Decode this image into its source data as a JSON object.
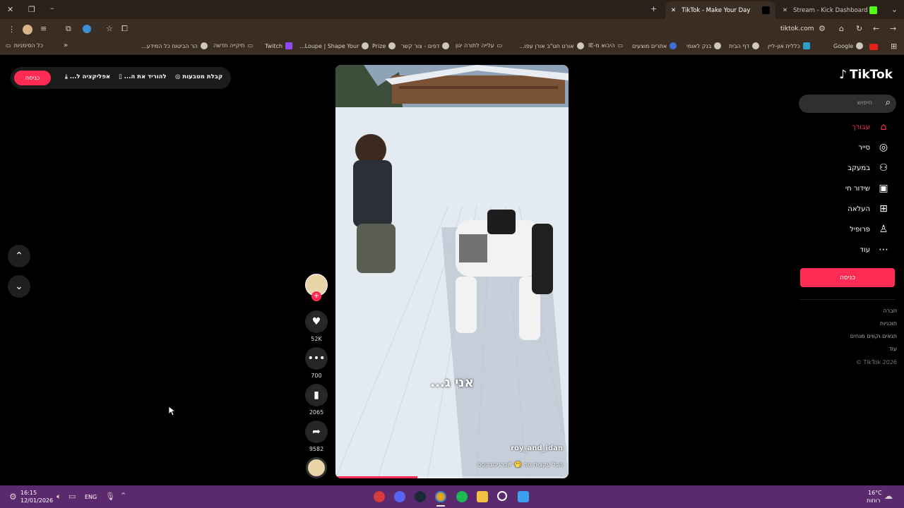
{
  "browser": {
    "tabs": [
      {
        "title": "TikTok - Make Your Day",
        "active": true
      },
      {
        "title": "Stream - Kick Dashboard",
        "active": false
      }
    ],
    "url": "tiktok.com",
    "bookmarks": [
      "Google",
      "כללית און-ליין",
      "דף הבית",
      "בנק לאומי",
      "אתרים מוצעים",
      "היבוא מ-IE",
      "אורט חט\"ב אורן עפו...",
      "עלייה לתורה יגון",
      "דפים - צור קשר",
      "Prize",
      "Loupe | Shape Your...",
      "Twitch",
      "תיקייה חדשה",
      "הר הביטוח כל המידע..."
    ],
    "all_bookmarks": "כל הסימניות"
  },
  "topbar": {
    "login": "כניסה",
    "coins": "קבלת מטבעות",
    "download": "להוריד את ה...",
    "app": "אפליקציה ל..."
  },
  "video": {
    "caption_overlay": "אני ג...",
    "username": "roy_and_idan",
    "description": "הכל עקבות סה 🤭 #כרגיגובקסט",
    "progress": 0.35
  },
  "actions": {
    "likes": "52K",
    "comments": "700",
    "saves": "2065",
    "shares": "9582"
  },
  "sidebar": {
    "logo": "TikTok",
    "search_placeholder": "חיפוש",
    "items": [
      {
        "label": "עבורך",
        "icon": "home-icon",
        "active": true
      },
      {
        "label": "סייר",
        "icon": "compass-icon"
      },
      {
        "label": "במעקב",
        "icon": "following-icon"
      },
      {
        "label": "שידור חי",
        "icon": "live-icon"
      },
      {
        "label": "העלאה",
        "icon": "upload-icon"
      },
      {
        "label": "פרופיל",
        "icon": "profile-icon"
      },
      {
        "label": "עוד",
        "icon": "more-icon"
      }
    ],
    "login_button": "כניסה",
    "footer": [
      "חברה",
      "תוכניות",
      "תנאים וקווים מנחים",
      "עוד",
      "TikTok 2026 ©"
    ]
  },
  "taskbar": {
    "time": "16:15",
    "date": "12/01/2026",
    "lang": "ENG",
    "weather_temp": "16°C",
    "weather_desc": "רוחות"
  },
  "colors": {
    "accent": "#fe2c55",
    "taskbar": "#5b2a6e",
    "browser": "#3a2e24"
  }
}
